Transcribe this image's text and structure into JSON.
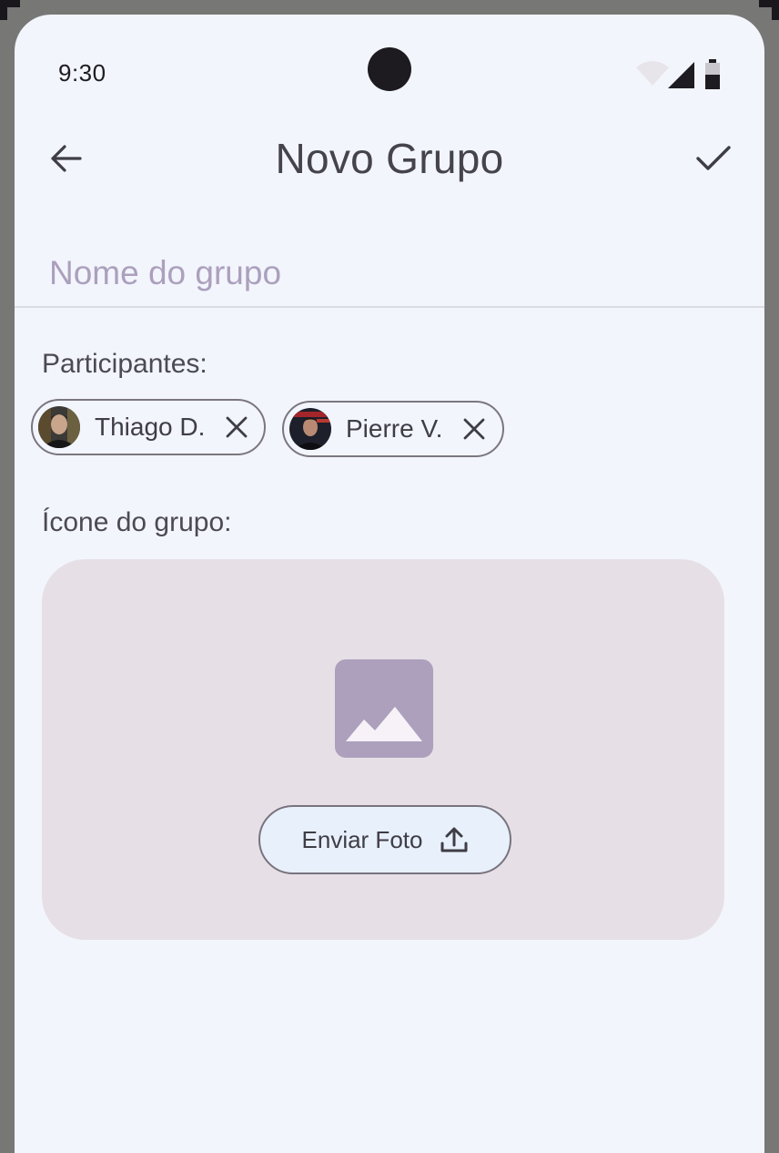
{
  "status_bar": {
    "time": "9:30",
    "icons": [
      "wifi-icon",
      "cellular-signal-icon",
      "battery-icon"
    ]
  },
  "app_bar": {
    "title": "Novo Grupo",
    "back_icon": "arrow-back-icon",
    "confirm_icon": "check-icon"
  },
  "group_name": {
    "placeholder": "Nome do grupo",
    "value": ""
  },
  "participants": {
    "label": "Participantes:",
    "items": [
      {
        "name": "Thiago D.",
        "remove_icon": "close-icon"
      },
      {
        "name": "Pierre V.",
        "remove_icon": "close-icon"
      }
    ]
  },
  "group_icon": {
    "label": "Ícone do grupo:",
    "placeholder_icon": "image-icon",
    "upload_button_label": "Enviar Foto",
    "upload_icon": "upload-icon"
  },
  "colors": {
    "background": "#f2f5fc",
    "placeholder_text": "#aca0bd",
    "card_background": "#e6e0e6",
    "button_background": "#e8f0fb",
    "title_text": "#45434b"
  }
}
